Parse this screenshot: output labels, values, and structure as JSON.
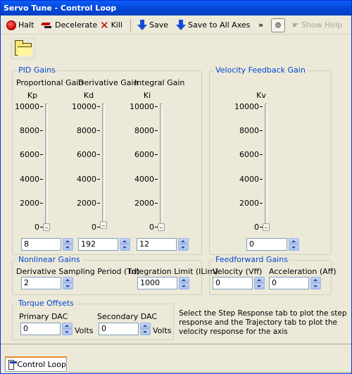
{
  "window": {
    "title": "Servo Tune - Control Loop"
  },
  "toolbar": {
    "halt": "Halt",
    "decelerate": "Decelerate",
    "kill": "Kill",
    "save": "Save",
    "save_all": "Save to All Axes",
    "overflow": "»",
    "show_help": "Show Help"
  },
  "pid": {
    "title": "PID Gains",
    "prop_label": "Proportional Gain",
    "deriv_label": "Derivative Gain",
    "integ_label": "Integral Gain",
    "kp": "Kp",
    "kd": "Kd",
    "ki": "Ki",
    "kp_value": "8",
    "kd_value": "192",
    "ki_value": "12",
    "slider_max": 10000,
    "kp_level": 0.0008,
    "kd_level": 0.0192,
    "ki_level": 0.0012
  },
  "velocity_feedback": {
    "title": "Velocity Feedback Gain",
    "kv": "Kv",
    "kv_value": "0",
    "kv_level": 0
  },
  "ticks": [
    "10000",
    "8000",
    "6000",
    "4000",
    "2000",
    "0"
  ],
  "nonlinear": {
    "title": "Nonlinear Gains",
    "td_label": "Derivative Sampling Period (Td)",
    "ilim_label": "Integration Limit (ILim)",
    "td_value": "2",
    "ilim_value": "1000"
  },
  "feedforward": {
    "title": "Feedforward Gains",
    "vff_label": "Velocity (Vff)",
    "aff_label": "Acceleration  (Aff)",
    "vff_value": "0",
    "aff_value": "0"
  },
  "torque": {
    "title": "Torque Offsets",
    "primary_label": "Primary DAC",
    "secondary_label": "Secondary DAC",
    "primary_value": "0",
    "secondary_value": "0",
    "unit": "Volts"
  },
  "help_text": "Select the Step Response tab to plot the step response and the Trajectory tab to plot the velocity response for the axis",
  "tabs": {
    "control_loop": "Control Loop"
  }
}
